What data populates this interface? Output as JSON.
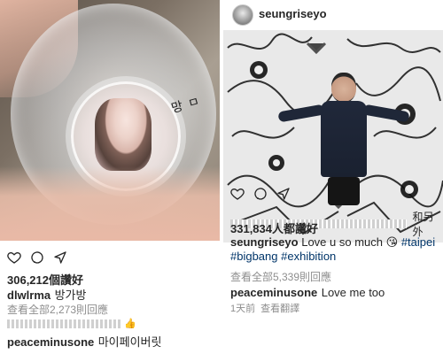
{
  "left_post": {
    "photo": {
      "handwriting": "망 ㅁ"
    },
    "likes": "306,212個讚好",
    "caption": {
      "username": "dlwlrma",
      "text": "방가방"
    },
    "view_comments": "查看全部2,273則回應",
    "comment": {
      "username": "peaceminusone",
      "text": "마이페이버릿"
    },
    "icons": [
      "heart-icon",
      "comment-icon",
      "share-icon"
    ]
  },
  "right_post": {
    "header": {
      "username": "seungriseyo"
    },
    "liked_by": "和另外",
    "likes": "331,834人都讚好",
    "caption": {
      "username": "seungriseyo",
      "text": "Love u so much",
      "emoji": "😘",
      "hashtags": [
        "#taipei",
        "#bigbang",
        "#exhibition"
      ]
    },
    "view_comments": "查看全部5,339則回應",
    "comment": {
      "username": "peaceminusone",
      "text": "Love me too"
    },
    "time": "1天前",
    "translate": "查看翻譯",
    "icons": [
      "heart-icon",
      "comment-icon",
      "share-icon"
    ]
  }
}
